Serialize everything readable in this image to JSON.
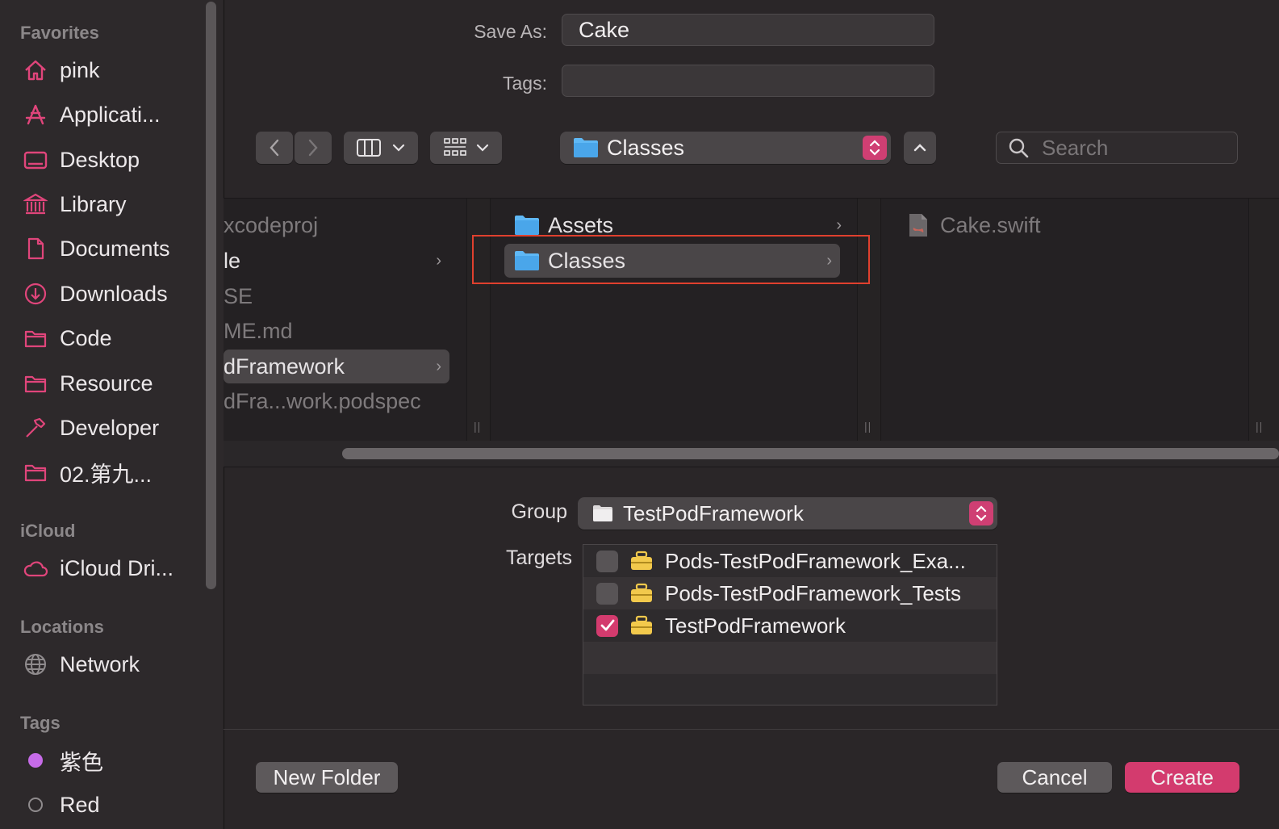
{
  "sidebar": {
    "favorites_header": "Favorites",
    "favorites": [
      {
        "label": "pink",
        "icon": "home-icon"
      },
      {
        "label": "Applicati...",
        "icon": "applications-icon"
      },
      {
        "label": "Desktop",
        "icon": "desktop-icon"
      },
      {
        "label": "Library",
        "icon": "library-icon"
      },
      {
        "label": "Documents",
        "icon": "document-icon"
      },
      {
        "label": "Downloads",
        "icon": "download-icon"
      },
      {
        "label": "Code",
        "icon": "folder-icon"
      },
      {
        "label": "Resource",
        "icon": "folder-icon"
      },
      {
        "label": "Developer",
        "icon": "hammer-icon"
      },
      {
        "label": "02.第九...",
        "icon": "folder-icon"
      }
    ],
    "icloud_header": "iCloud",
    "icloud": [
      {
        "label": "iCloud Dri...",
        "icon": "cloud-icon"
      }
    ],
    "locations_header": "Locations",
    "locations": [
      {
        "label": "Network",
        "icon": "network-icon"
      }
    ],
    "tags_header": "Tags",
    "tags": [
      {
        "label": "紫色",
        "color": "#c66be8"
      },
      {
        "label": "Red",
        "color": ""
      }
    ]
  },
  "form": {
    "save_as_label": "Save As:",
    "save_as_value": "Cake",
    "tags_label": "Tags:",
    "tags_value": ""
  },
  "toolbar": {
    "location": "Classes",
    "search_placeholder": "Search"
  },
  "browser": {
    "col1": [
      {
        "label": "xcodeproj",
        "dim": true,
        "chevron": false
      },
      {
        "label": "le",
        "dim": false,
        "chevron": true
      },
      {
        "label": "SE",
        "dim": true,
        "chevron": false
      },
      {
        "label": "ME.md",
        "dim": true,
        "chevron": false
      },
      {
        "label": "dFramework",
        "dim": false,
        "chevron": true,
        "selected": true
      },
      {
        "label": "dFra...work.podspec",
        "dim": true,
        "chevron": false
      }
    ],
    "col2": [
      {
        "label": "Assets",
        "chevron": true
      },
      {
        "label": "Classes",
        "chevron": true,
        "selected": true
      }
    ],
    "col3": [
      {
        "label": "Cake.swift",
        "dim": true
      }
    ]
  },
  "group": {
    "label": "Group",
    "value": "TestPodFramework"
  },
  "targets": {
    "label": "Targets",
    "items": [
      {
        "label": "Pods-TestPodFramework_Exa...",
        "checked": false
      },
      {
        "label": "Pods-TestPodFramework_Tests",
        "checked": false
      },
      {
        "label": "TestPodFramework",
        "checked": true
      }
    ]
  },
  "buttons": {
    "new_folder": "New Folder",
    "cancel": "Cancel",
    "create": "Create"
  },
  "colors": {
    "accent": "#d33b6e",
    "sidebar_icon": "#e0457b",
    "folder_blue": "#5fb8f5"
  }
}
